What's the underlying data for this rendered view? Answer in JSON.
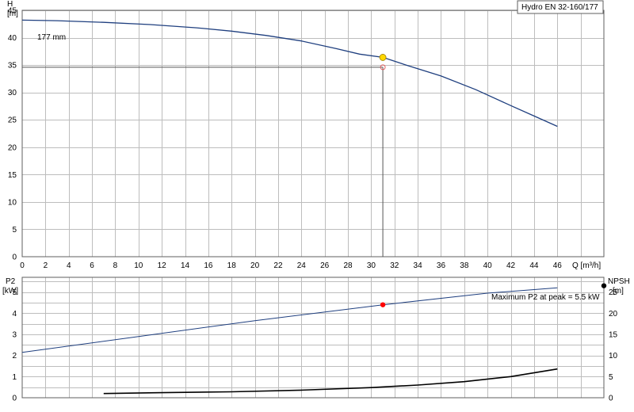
{
  "chart_data": [
    {
      "type": "line",
      "title": "Hydro EN 32-160/177",
      "ylabel_line1": "H",
      "ylabel_line2": "[m]",
      "xlabel": "Q [m³/h]",
      "xlim": [
        0,
        50
      ],
      "ylim": [
        0,
        45
      ],
      "x_ticks": [
        0,
        2,
        4,
        6,
        8,
        10,
        12,
        14,
        16,
        18,
        20,
        22,
        24,
        26,
        28,
        30,
        32,
        34,
        36,
        38,
        40,
        42,
        44,
        46
      ],
      "y_ticks": [
        0,
        5,
        10,
        15,
        20,
        25,
        30,
        35,
        40,
        45
      ],
      "grid": true,
      "series": [
        {
          "name": "177 mm",
          "color": "#1f3f7f",
          "x": [
            0,
            3,
            7,
            11,
            15,
            18,
            21,
            24,
            27,
            29,
            31,
            33,
            36,
            39,
            42,
            44,
            46
          ],
          "y": [
            43.2,
            43.1,
            42.8,
            42.4,
            41.8,
            41.2,
            40.4,
            39.4,
            38.0,
            37.0,
            36.4,
            35.0,
            33.0,
            30.5,
            27.6,
            25.7,
            23.8
          ]
        }
      ],
      "operating_point": {
        "x": 31,
        "y": 36.4,
        "color": "#ffd700"
      },
      "required_point": {
        "x": 31,
        "y": 34.6,
        "color": "#e06060"
      }
    },
    {
      "type": "line",
      "ylabel_left_line1": "P2",
      "ylabel_left_line2": "[kW]",
      "ylabel_right_line1": "NPSH",
      "ylabel_right_line2": "[m]",
      "xlim": [
        0,
        50
      ],
      "ylim_left": [
        0,
        5.7
      ],
      "ylim_right": [
        0,
        28.5
      ],
      "y_ticks_left": [
        0,
        1,
        2,
        3,
        4,
        5
      ],
      "y_ticks_right": [
        0,
        5,
        10,
        15,
        20,
        25
      ],
      "grid": true,
      "annotation": "Maximum P2 at peak = 5.5 kW",
      "annotation_marker_value": 26.5,
      "series": [
        {
          "name": "P2",
          "axis": "left",
          "color": "#1f3f7f",
          "x": [
            0,
            10,
            20,
            31,
            40,
            46
          ],
          "y": [
            2.15,
            2.9,
            3.65,
            4.4,
            4.95,
            5.2
          ]
        },
        {
          "name": "NPSH",
          "axis": "right",
          "color": "#000000",
          "x": [
            7,
            12,
            18,
            24,
            30,
            34,
            38,
            42,
            46
          ],
          "y": [
            1.0,
            1.2,
            1.4,
            1.8,
            2.4,
            3.0,
            3.8,
            5.0,
            6.8
          ]
        }
      ],
      "p2_operating_point": {
        "x": 31,
        "y": 4.4,
        "color": "#ff0000"
      }
    }
  ]
}
